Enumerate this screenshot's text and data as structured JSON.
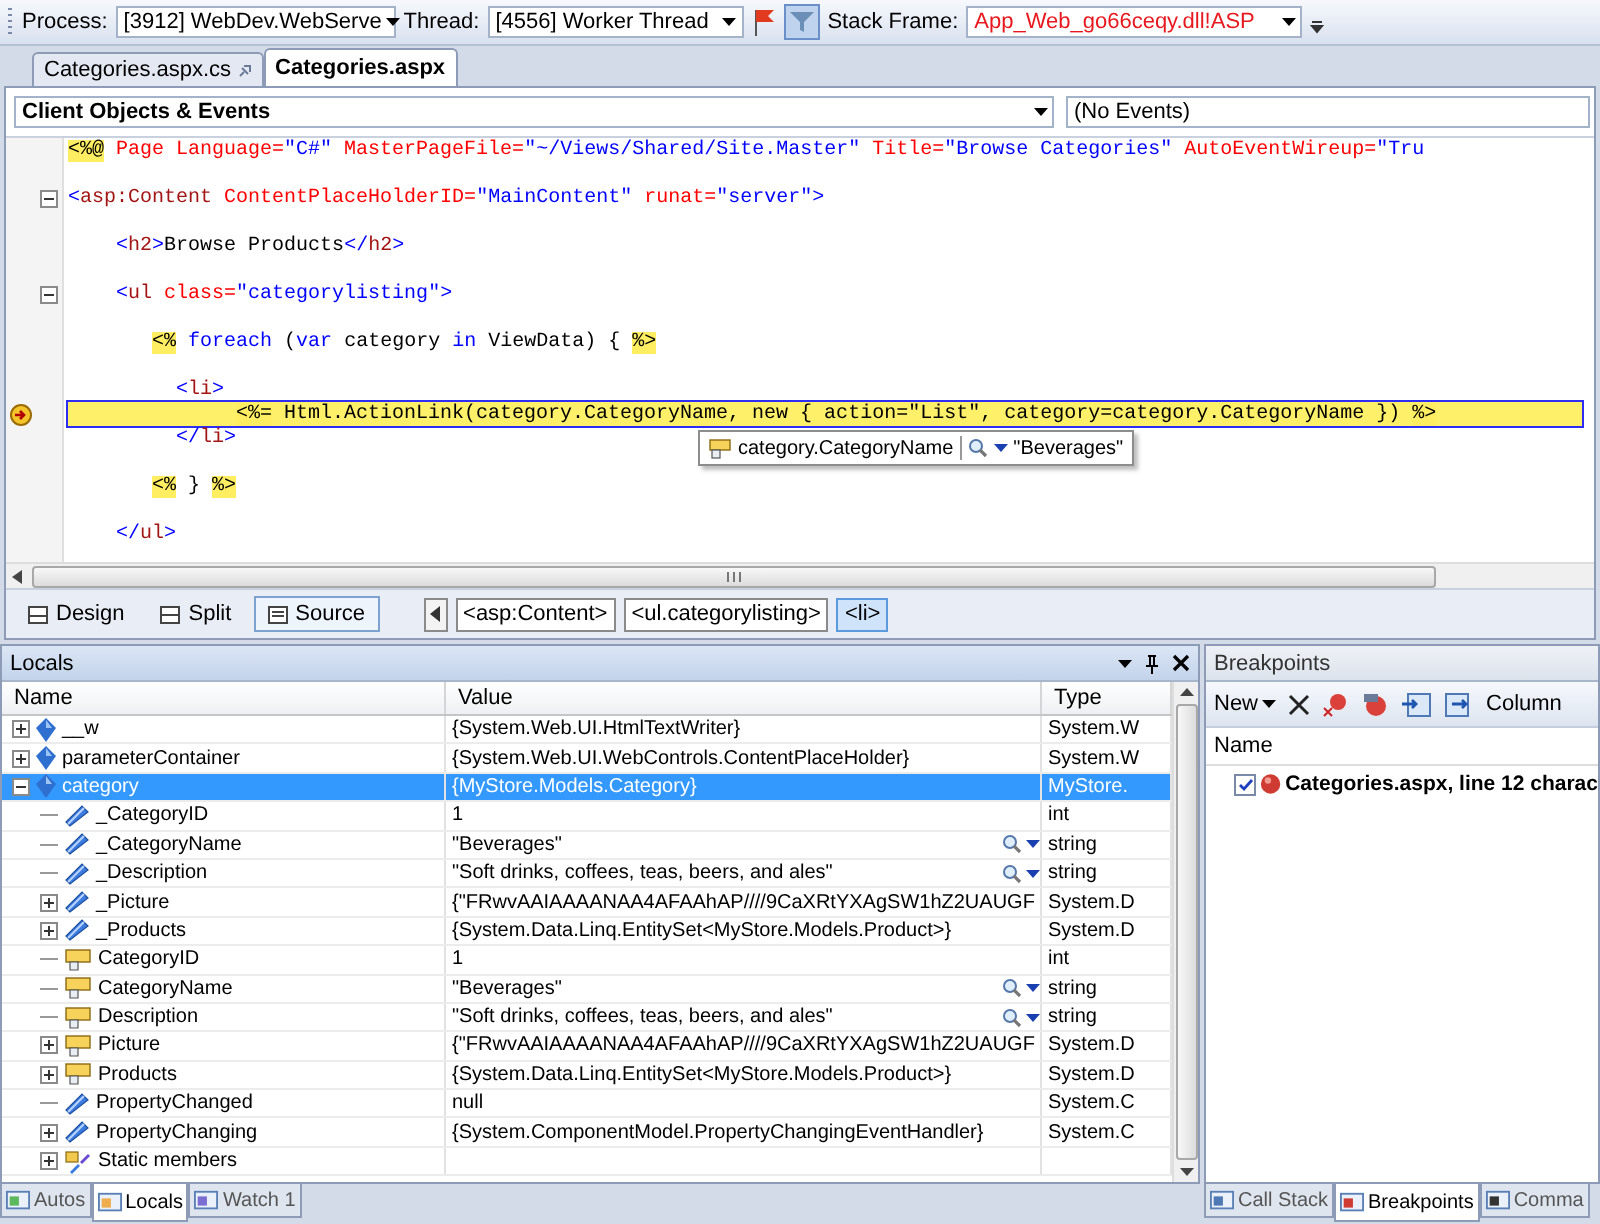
{
  "debug_toolbar": {
    "process_label": "Process:",
    "process": "[3912] WebDev.WebServe",
    "thread_label": "Thread:",
    "thread": "[4556] Worker Thread",
    "filter_on": true,
    "stack_frame_label": "Stack Frame:",
    "stack_frame": "App_Web_go66ceqy.dll!ASP"
  },
  "document_tabs": [
    {
      "label": "Categories.aspx.cs",
      "selected": false
    },
    {
      "label": "Categories.aspx",
      "selected": true
    }
  ],
  "navigation": {
    "objects": "Client Objects & Events",
    "events": "(No Events)"
  },
  "code_lines": [
    {
      "current": false,
      "tokens": [
        {
          "kind": "delim",
          "text": "<%@"
        },
        {
          "kind": "attr",
          "text": " Page Language="
        },
        {
          "kind": "value",
          "text": "\"C#\""
        },
        {
          "kind": "attr",
          "text": " MasterPageFile="
        },
        {
          "kind": "value",
          "text": "\"~/Views/Shared/Site.Master\""
        },
        {
          "kind": "attr",
          "text": " Title="
        },
        {
          "kind": "value",
          "text": "\"Browse Categories\""
        },
        {
          "kind": "attr",
          "text": " AutoEventWireup="
        },
        {
          "kind": "value",
          "text": "\"Tru"
        }
      ]
    },
    {
      "current": false,
      "foldable": true,
      "tokens": [
        {
          "kind": "tag",
          "text": "<"
        },
        {
          "kind": "element",
          "text": "asp:Content"
        },
        {
          "kind": "attr",
          "text": " ContentPlaceHolderID="
        },
        {
          "kind": "value",
          "text": "\"MainContent\""
        },
        {
          "kind": "attr",
          "text": " runat="
        },
        {
          "kind": "value",
          "text": "\"server\""
        },
        {
          "kind": "tag",
          "text": ">"
        }
      ]
    },
    {
      "current": false,
      "tokens": [
        {
          "kind": "tag",
          "text": "<"
        },
        {
          "kind": "element",
          "text": "h2"
        },
        {
          "kind": "tag",
          "text": ">"
        },
        {
          "kind": "text",
          "text": "Browse Products"
        },
        {
          "kind": "tag",
          "text": "</"
        },
        {
          "kind": "element",
          "text": "h2"
        },
        {
          "kind": "tag",
          "text": ">"
        }
      ]
    },
    {
      "current": false,
      "foldable": true,
      "tokens": [
        {
          "kind": "tag",
          "text": "<"
        },
        {
          "kind": "element",
          "text": "ul"
        },
        {
          "kind": "attr",
          "text": " class="
        },
        {
          "kind": "value",
          "text": "\"categorylisting\""
        },
        {
          "kind": "tag",
          "text": ">"
        }
      ]
    },
    {
      "current": false,
      "tokens": [
        {
          "kind": "delim",
          "text": "<%"
        },
        {
          "kind": "keyword",
          "text": " foreach"
        },
        {
          "kind": "text",
          "text": " ("
        },
        {
          "kind": "keyword",
          "text": "var"
        },
        {
          "kind": "text",
          "text": " category "
        },
        {
          "kind": "keyword",
          "text": "in"
        },
        {
          "kind": "text",
          "text": " ViewData) { "
        },
        {
          "kind": "delim",
          "text": "%>"
        }
      ]
    },
    {
      "current": false,
      "tokens": [
        {
          "kind": "tag",
          "text": "<"
        },
        {
          "kind": "element",
          "text": "li"
        },
        {
          "kind": "tag",
          "text": ">"
        }
      ]
    },
    {
      "current": true,
      "tokens": [
        {
          "kind": "delim",
          "text": "<%="
        },
        {
          "kind": "text",
          "text": " Html.ActionLink(category.CategoryName, new { action=\"List\", category=category.CategoryName }) "
        },
        {
          "kind": "delim",
          "text": "%>"
        }
      ]
    },
    {
      "current": false,
      "tokens": [
        {
          "kind": "tag",
          "text": "</"
        },
        {
          "kind": "element",
          "text": "li"
        },
        {
          "kind": "tag",
          "text": ">"
        }
      ]
    },
    {
      "current": false,
      "tokens": [
        {
          "kind": "delim",
          "text": "<%"
        },
        {
          "kind": "text",
          "text": " } "
        },
        {
          "kind": "delim",
          "text": "%>"
        }
      ]
    },
    {
      "current": false,
      "tokens": [
        {
          "kind": "tag",
          "text": "</"
        },
        {
          "kind": "element",
          "text": "ul"
        },
        {
          "kind": "tag",
          "text": ">"
        }
      ]
    }
  ],
  "datatip": {
    "expression": "category.CategoryName",
    "value": "\"Beverages\""
  },
  "view_buttons": [
    {
      "label": "Design",
      "selected": false
    },
    {
      "label": "Split",
      "selected": false
    },
    {
      "label": "Source",
      "selected": true
    }
  ],
  "breadcrumbs": [
    {
      "label": "<asp:Content>",
      "selected": false
    },
    {
      "label": "<ul.categorylisting>",
      "selected": false
    },
    {
      "label": "<li>",
      "selected": true
    }
  ],
  "locals": {
    "title": "Locals",
    "columns": [
      "Name",
      "Value",
      "Type"
    ],
    "rows": [
      {
        "name": "__w",
        "value": "{System.Web.UI.HtmlTextWriter}",
        "type": "System.W",
        "kind": "local",
        "expanded": false,
        "visualizer": false,
        "selected": false
      },
      {
        "name": "parameterContainer",
        "value": "{System.Web.UI.WebControls.ContentPlaceHolder}",
        "type": "System.W",
        "kind": "local",
        "expanded": false,
        "visualizer": false,
        "selected": false
      },
      {
        "name": "category",
        "value": "{MyStore.Models.Category}",
        "type": "MyStore.",
        "kind": "local",
        "expanded": true,
        "visualizer": false,
        "selected": true,
        "children": [
          {
            "name": "_CategoryID",
            "value": "1",
            "type": "int",
            "kind": "field",
            "visualizer": false,
            "selected": false
          },
          {
            "name": "_CategoryName",
            "value": "\"Beverages\"",
            "type": "string",
            "kind": "field",
            "visualizer": true,
            "selected": false
          },
          {
            "name": "_Description",
            "value": "\"Soft drinks, coffees, teas, beers, and ales\"",
            "type": "string",
            "kind": "field",
            "visualizer": true,
            "selected": false
          },
          {
            "name": "_Picture",
            "value": "{\"FRwvAAIAAAANAA4AFAAhAP////9CaXRtYXAgSW1hZ2UAUGF",
            "type": "System.D",
            "kind": "field",
            "expanded": false,
            "visualizer": false,
            "selected": false
          },
          {
            "name": "_Products",
            "value": "{System.Data.Linq.EntitySet<MyStore.Models.Product>}",
            "type": "System.D",
            "kind": "field",
            "expanded": false,
            "visualizer": false,
            "selected": false
          },
          {
            "name": "CategoryID",
            "value": "1",
            "type": "int",
            "kind": "property",
            "visualizer": false,
            "selected": false
          },
          {
            "name": "CategoryName",
            "value": "\"Beverages\"",
            "type": "string",
            "kind": "property",
            "visualizer": true,
            "selected": false
          },
          {
            "name": "Description",
            "value": "\"Soft drinks, coffees, teas, beers, and ales\"",
            "type": "string",
            "kind": "property",
            "visualizer": true,
            "selected": false
          },
          {
            "name": "Picture",
            "value": "{\"FRwvAAIAAAANAA4AFAAhAP////9CaXRtYXAgSW1hZ2UAUGF",
            "type": "System.D",
            "kind": "property",
            "expanded": false,
            "visualizer": false,
            "selected": false
          },
          {
            "name": "Products",
            "value": "{System.Data.Linq.EntitySet<MyStore.Models.Product>}",
            "type": "System.D",
            "kind": "property",
            "expanded": false,
            "visualizer": false,
            "selected": false
          },
          {
            "name": "PropertyChanged",
            "value": "null",
            "type": "System.C",
            "kind": "field",
            "visualizer": false,
            "selected": false
          },
          {
            "name": "PropertyChanging",
            "value": "{System.ComponentModel.PropertyChangingEventHandler}",
            "type": "System.C",
            "kind": "field",
            "expanded": false,
            "visualizer": false,
            "selected": false
          },
          {
            "name": "Static members",
            "kind": "static",
            "expanded": false,
            "visualizer": false,
            "selected": false
          }
        ]
      }
    ]
  },
  "locals_tabs": [
    {
      "label": "Autos",
      "selected": false
    },
    {
      "label": "Locals",
      "selected": true
    },
    {
      "label": "Watch 1",
      "selected": false
    }
  ],
  "breakpoints": {
    "title": "Breakpoints",
    "new_label": "New",
    "columns_label": "Column",
    "column": "Name",
    "items": [
      {
        "label": "Categories.aspx, line 12 charac",
        "checked": true
      }
    ]
  },
  "breakpoints_tabs": [
    {
      "label": "Call Stack",
      "selected": false
    },
    {
      "label": "Breakpoints",
      "selected": true
    },
    {
      "label": "Comma",
      "selected": false
    }
  ]
}
